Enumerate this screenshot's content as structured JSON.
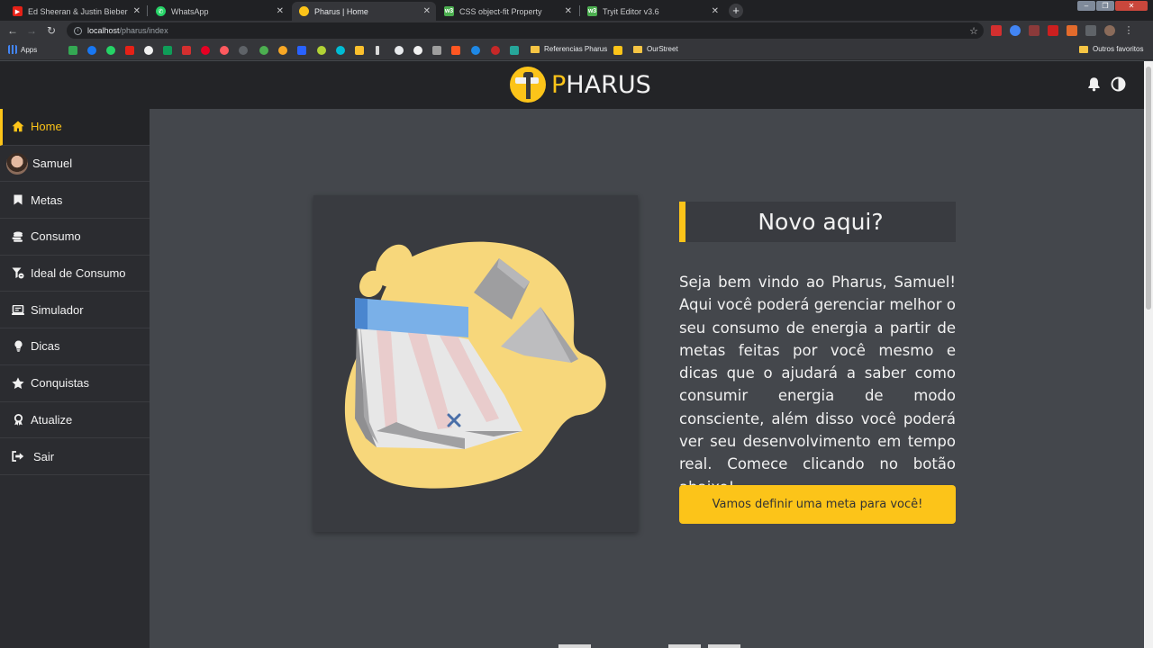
{
  "browser": {
    "tabs": [
      {
        "title": "Ed Sheeran & Justin Bieber - I Do",
        "favicon_color": "#e62117",
        "active": false
      },
      {
        "title": "WhatsApp",
        "favicon_color": "#25d366",
        "active": false
      },
      {
        "title": "Pharus | Home",
        "favicon_color": "#fcc419",
        "active": true
      },
      {
        "title": "CSS object-fit Property",
        "favicon_color": "#4caf50",
        "active": false
      },
      {
        "title": "Tryit Editor v3.6",
        "favicon_color": "#4caf50",
        "active": false
      }
    ],
    "address": {
      "host": "localhost",
      "path": "/pharus/index"
    },
    "bookmarks": {
      "apps_label": "Apps",
      "folders": [
        "Referencias Pharus",
        "OurStreet"
      ],
      "other_label": "Outros favoritos"
    }
  },
  "app": {
    "logo": {
      "first_letter": "P",
      "rest": "HARUS"
    },
    "sidebar": {
      "items": [
        {
          "label": "Home",
          "icon": "home-icon",
          "active": true
        },
        {
          "label": "Samuel",
          "icon": "avatar",
          "active": false
        },
        {
          "label": "Metas",
          "icon": "bookmark-icon",
          "active": false
        },
        {
          "label": "Consumo",
          "icon": "coins-icon",
          "active": false
        },
        {
          "label": "Ideal de Consumo",
          "icon": "filter-icon",
          "active": false
        },
        {
          "label": "Simulador",
          "icon": "laptop-icon",
          "active": false
        },
        {
          "label": "Dicas",
          "icon": "lightbulb-icon",
          "active": false
        },
        {
          "label": "Conquistas",
          "icon": "star-icon",
          "active": false
        },
        {
          "label": "Atualize",
          "icon": "award-icon",
          "active": false
        },
        {
          "label": "Sair",
          "icon": "sign-out-icon",
          "active": false
        }
      ]
    },
    "main": {
      "title": "Novo aqui?",
      "welcome_text": "Seja bem vindo ao Pharus, Samuel! Aqui você poderá gerenciar melhor o seu consumo de energia a partir de metas feitas por você mesmo e dicas que o ajudará a saber como consumir energia de modo consciente, além disso você poderá ver seu desenvolvimento em tempo real. Comece clicando no botão abaixo!",
      "cta_label": "Vamos definir uma meta para você!"
    },
    "colors": {
      "accent": "#fcc419",
      "header": "#232427",
      "sidebar": "#2b2c30",
      "content": "#44474c"
    }
  }
}
